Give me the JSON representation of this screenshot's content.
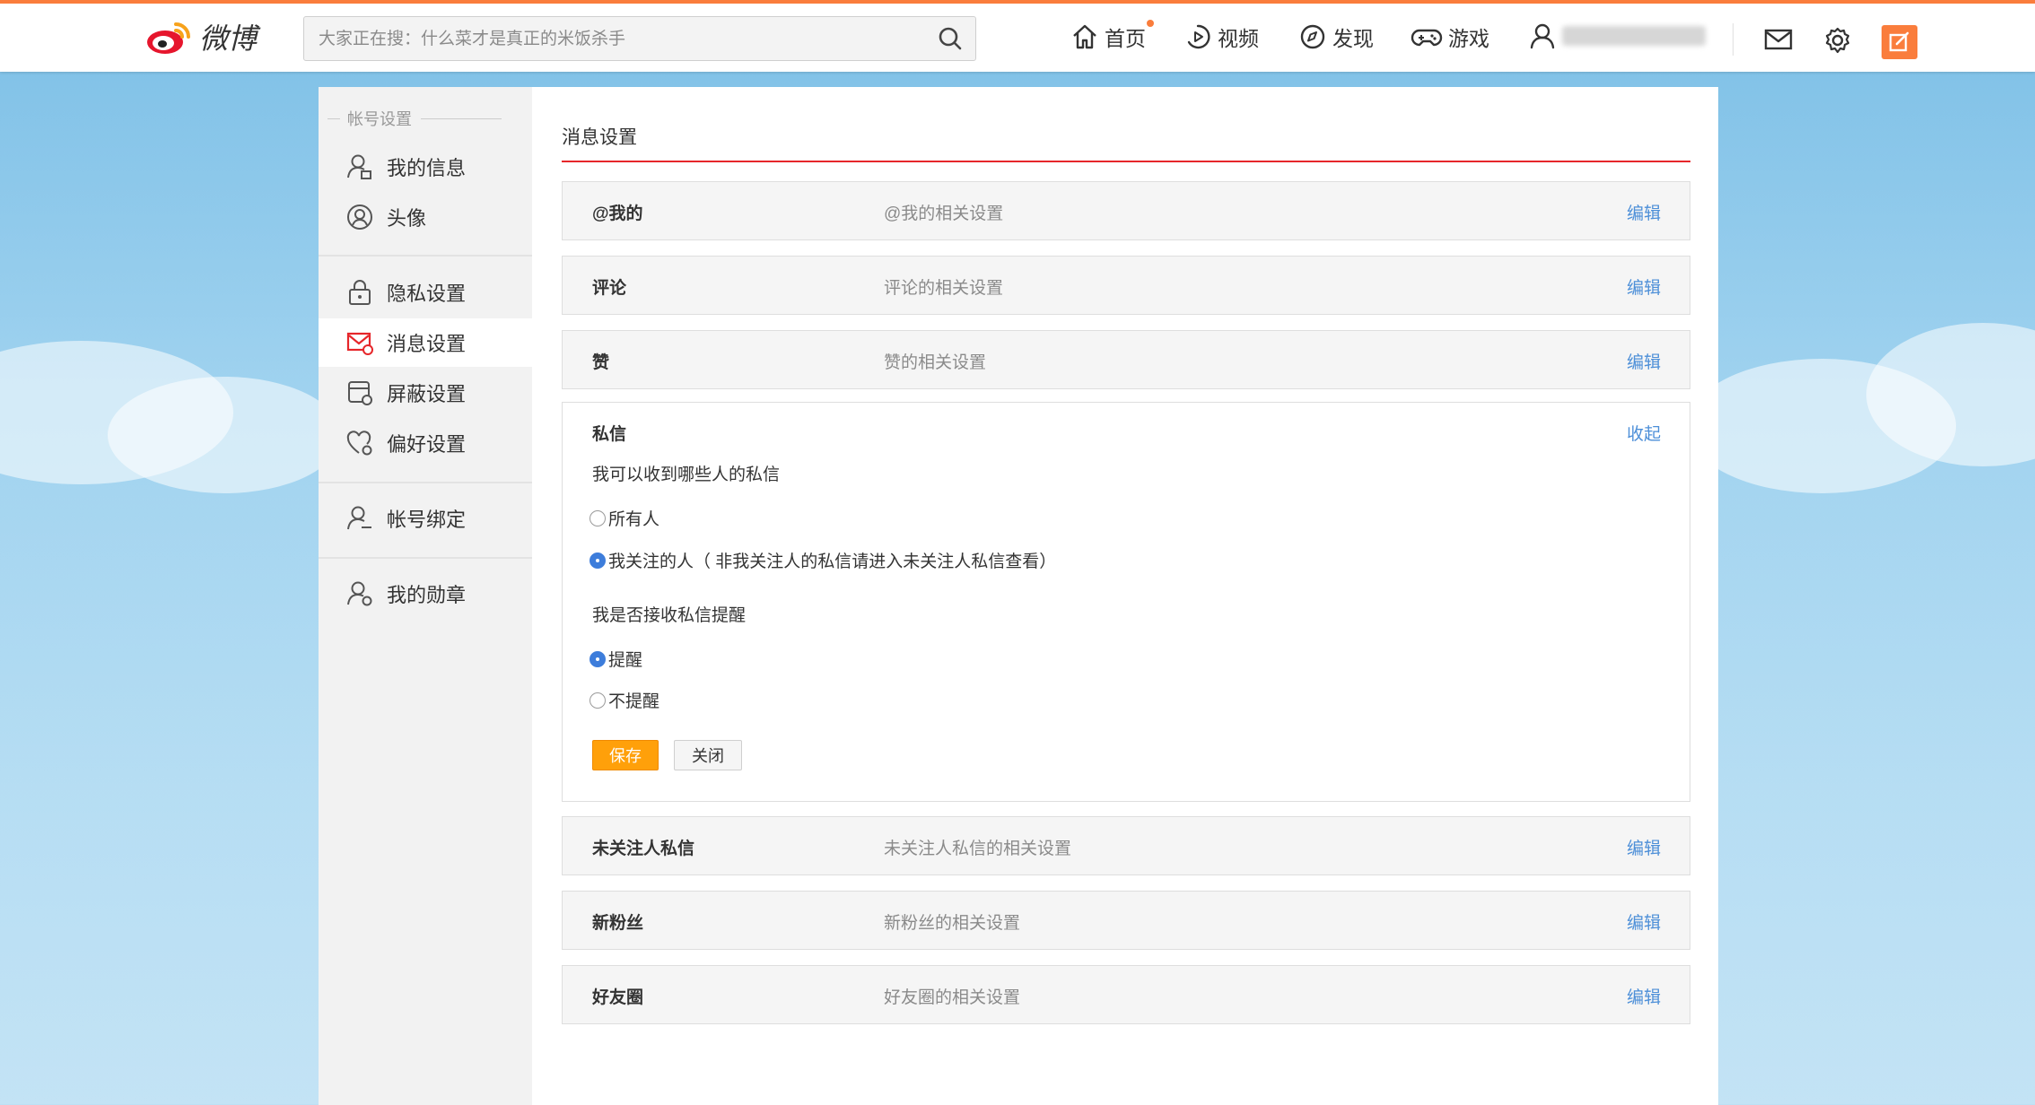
{
  "brand": {
    "logo_text": "微博",
    "accent": "#fa7d3c"
  },
  "search": {
    "placeholder": "大家正在搜：什么菜才是真正的米饭杀手"
  },
  "nav": {
    "home": "首页",
    "video": "视频",
    "discover": "发现",
    "game": "游戏"
  },
  "sidebar": {
    "heading": "帐号设置",
    "items": [
      {
        "label": "我的信息",
        "icon": "user-info-icon"
      },
      {
        "label": "头像",
        "icon": "avatar-icon"
      },
      {
        "label": "隐私设置",
        "icon": "lock-icon"
      },
      {
        "label": "消息设置",
        "icon": "message-icon",
        "active": true
      },
      {
        "label": "屏蔽设置",
        "icon": "shield-icon"
      },
      {
        "label": "偏好设置",
        "icon": "heart-gear-icon"
      },
      {
        "label": "帐号绑定",
        "icon": "user-bind-icon"
      },
      {
        "label": "我的勋章",
        "icon": "medal-icon"
      }
    ]
  },
  "main": {
    "title": "消息设置",
    "rows": [
      {
        "name": "@我的",
        "desc": "@我的相关设置",
        "action": "编辑"
      },
      {
        "name": "评论",
        "desc": "评论的相关设置",
        "action": "编辑"
      },
      {
        "name": "赞",
        "desc": "赞的相关设置",
        "action": "编辑"
      },
      {
        "name": "未关注人私信",
        "desc": "未关注人私信的相关设置",
        "action": "编辑"
      },
      {
        "name": "新粉丝",
        "desc": "新粉丝的相关设置",
        "action": "编辑"
      },
      {
        "name": "好友圈",
        "desc": "好友圈的相关设置",
        "action": "编辑"
      }
    ],
    "dm_panel": {
      "title": "私信",
      "collapse": "收起",
      "q1": "我可以收到哪些人的私信",
      "q1_options": [
        {
          "label": "所有人",
          "selected": false
        },
        {
          "label": "我关注的人（ 非我关注人的私信请进入未关注人私信查看）",
          "selected": true
        }
      ],
      "q2": "我是否接收私信提醒",
      "q2_options": [
        {
          "label": "提醒",
          "selected": true
        },
        {
          "label": "不提醒",
          "selected": false
        }
      ],
      "save": "保存",
      "close": "关闭"
    }
  }
}
